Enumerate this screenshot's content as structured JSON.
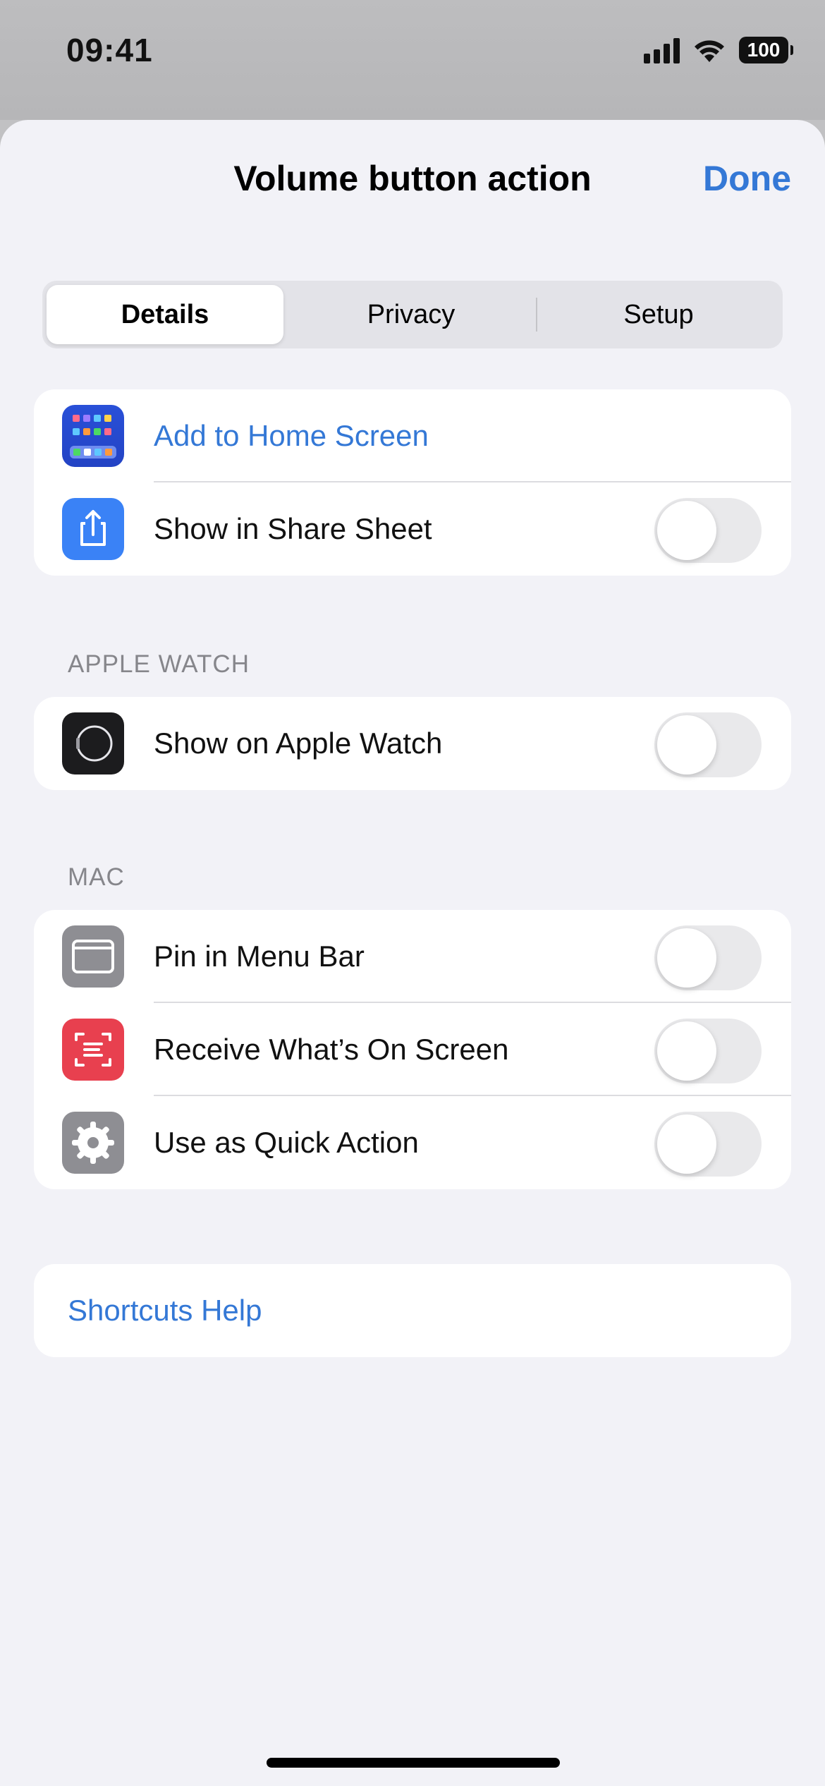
{
  "status_bar": {
    "time": "09:41",
    "battery": "100"
  },
  "nav": {
    "title": "Volume button action",
    "done_label": "Done"
  },
  "tabs": [
    {
      "label": "Details",
      "selected": true
    },
    {
      "label": "Privacy",
      "selected": false
    },
    {
      "label": "Setup",
      "selected": false
    }
  ],
  "general_group": {
    "items": [
      {
        "label": "Add to Home Screen",
        "icon": "home-screen-icon",
        "type": "link"
      },
      {
        "label": "Show in Share Sheet",
        "icon": "share-icon",
        "type": "toggle",
        "on": false
      }
    ]
  },
  "apple_watch": {
    "header": "APPLE WATCH",
    "items": [
      {
        "label": "Show on Apple Watch",
        "icon": "apple-watch-icon",
        "type": "toggle",
        "on": false
      }
    ]
  },
  "mac": {
    "header": "MAC",
    "items": [
      {
        "label": "Pin in Menu Bar",
        "icon": "menu-bar-icon",
        "type": "toggle",
        "on": false
      },
      {
        "label": "Receive What’s On Screen",
        "icon": "screen-capture-icon",
        "type": "toggle",
        "on": false
      },
      {
        "label": "Use as Quick Action",
        "icon": "gear-icon",
        "type": "toggle",
        "on": false
      }
    ]
  },
  "help": {
    "label": "Shortcuts Help"
  },
  "colors": {
    "accent": "#3478d6",
    "background": "#f2f2f7",
    "toggle_off": "#e9e9eb",
    "share_icon_bg": "#3a82f6",
    "watch_icon_bg": "#1c1c1e",
    "menubar_icon_bg": "#8e8e93",
    "screen_icon_bg": "#e8404f",
    "gear_icon_bg": "#8e8e93"
  }
}
